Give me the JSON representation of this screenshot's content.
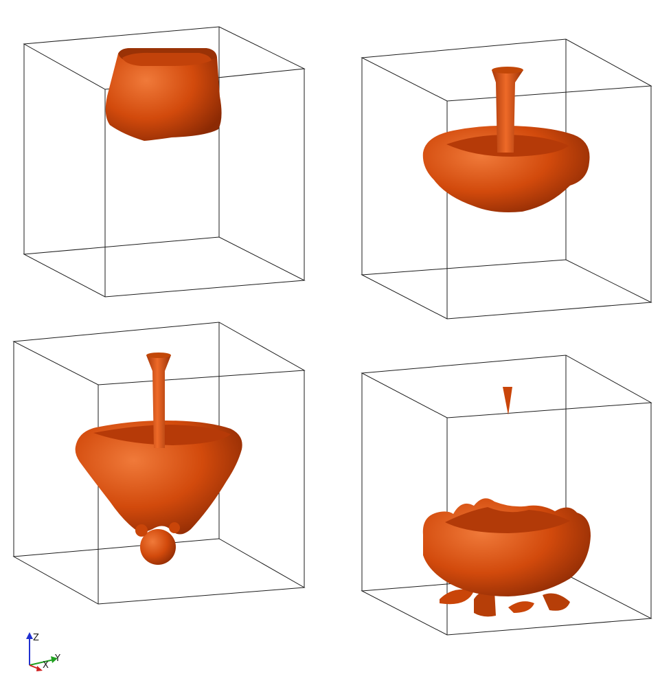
{
  "figure": {
    "panels": [
      {
        "name": "panel-top-left"
      },
      {
        "name": "panel-top-right"
      },
      {
        "name": "panel-bottom-left"
      },
      {
        "name": "panel-bottom-right"
      }
    ],
    "surface_color": "#d24a0c",
    "surface_highlight": "#f07a3a",
    "surface_shadow": "#8c2a04",
    "box_edge_color": "#1a1a1a"
  },
  "orientation_axes": {
    "z_label": "Z",
    "x_label": "X",
    "y_label": "Y",
    "z_color": "#2030d0",
    "x_color": "#d02020",
    "y_color": "#20a020"
  }
}
